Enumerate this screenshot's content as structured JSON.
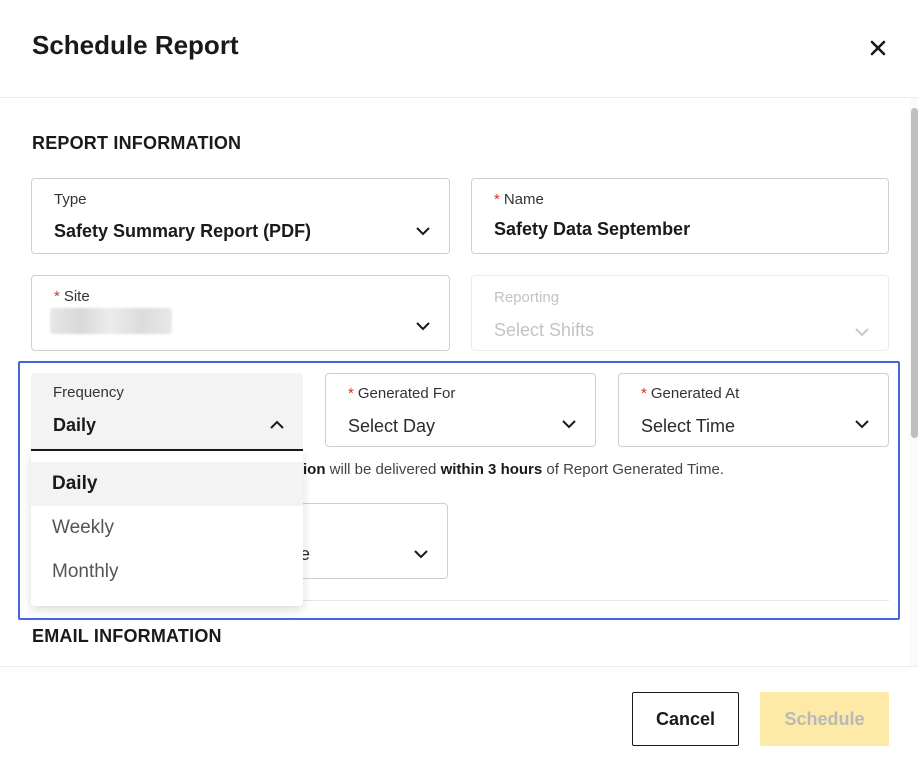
{
  "dialog": {
    "title": "Schedule Report"
  },
  "report_section": {
    "title": "REPORT INFORMATION"
  },
  "email_section": {
    "title": "EMAIL INFORMATION"
  },
  "fields": {
    "type": {
      "label": "Type",
      "value": "Safety Summary Report (PDF)"
    },
    "name": {
      "required_mark": "*",
      "label": "Name",
      "value": "Safety Data September"
    },
    "site": {
      "required_mark": "*",
      "label": "Site",
      "value": ""
    },
    "reporting": {
      "label": "Reporting",
      "placeholder": "Select Shifts",
      "disabled": true
    },
    "frequency": {
      "label": "Frequency",
      "value": "Daily",
      "expanded": true
    },
    "generated_for": {
      "required_mark": "*",
      "label": "Generated For",
      "placeholder": "Select Day"
    },
    "generated_at": {
      "required_mark": "*",
      "label": "Generated At",
      "placeholder": "Select Time"
    },
    "obscured_select": {
      "visible_fragment": "e"
    }
  },
  "frequency_options": [
    "Daily",
    "Weekly",
    "Monthly"
  ],
  "frequency_selected": "Daily",
  "note": {
    "bold_start": "tion",
    "text_1": " will be delivered ",
    "bold_mid": "within 3 hours",
    "text_2": " of Report Generated Time."
  },
  "footer": {
    "cancel_label": "Cancel",
    "schedule_label": "Schedule",
    "schedule_disabled": true
  },
  "colors": {
    "accent_outline": "#4a63e0",
    "required": "#d93025",
    "schedule_disabled_bg": "#fdeaa6"
  },
  "icons": {
    "close": "close-icon",
    "chevron": "chevron-down-icon",
    "chevron_up": "chevron-up-icon"
  }
}
